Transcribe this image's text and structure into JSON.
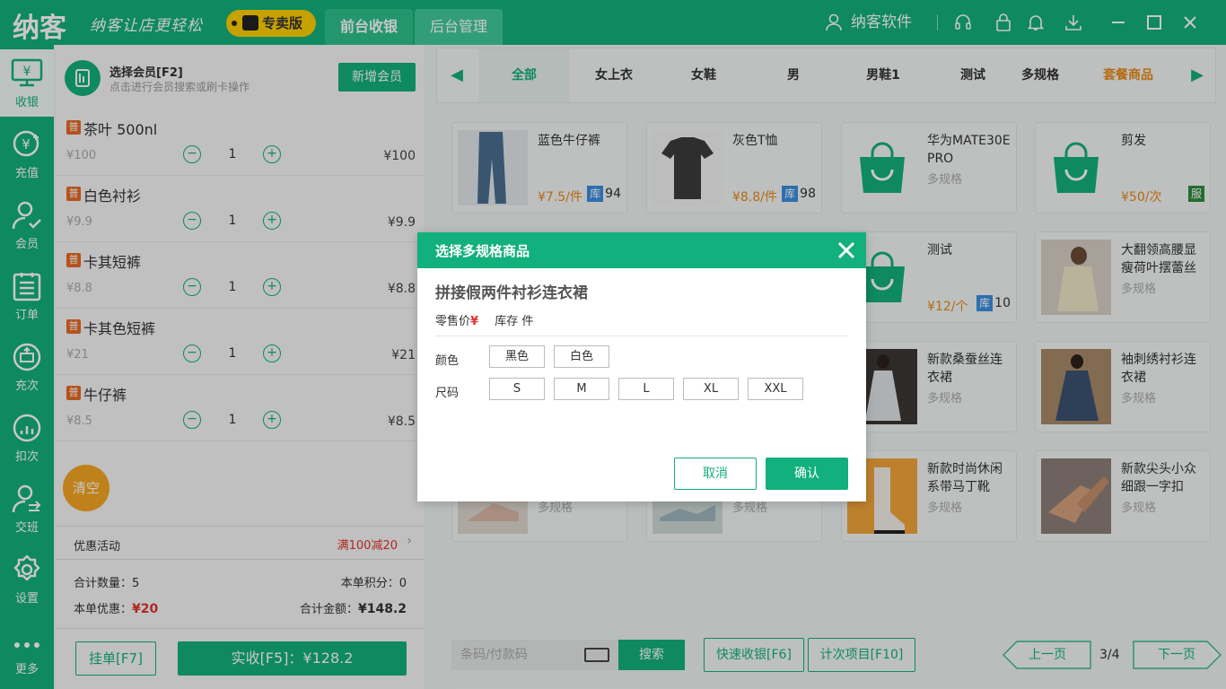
{
  "app": {
    "logo": "纳客",
    "slogan": "纳客让店更轻松",
    "edition": "专卖版",
    "tabs": [
      "前台收银",
      "后台管理"
    ],
    "user": "纳客软件"
  },
  "sidebar": [
    {
      "label": "收银",
      "icon": "cashier-icon"
    },
    {
      "label": "充值",
      "icon": "recharge-icon"
    },
    {
      "label": "会员",
      "icon": "member-icon"
    },
    {
      "label": "订单",
      "icon": "order-icon"
    },
    {
      "label": "充次",
      "icon": "recharge-times-icon"
    },
    {
      "label": "扣次",
      "icon": "deduct-times-icon"
    },
    {
      "label": "交班",
      "icon": "handover-icon"
    },
    {
      "label": "设置",
      "icon": "settings-icon"
    },
    {
      "label": "更多",
      "icon": "more-icon"
    }
  ],
  "member": {
    "title": "选择会员[F2]",
    "subtitle": "点击进行会员搜索或刷卡操作",
    "add_button": "新增会员"
  },
  "cart": [
    {
      "badge": "普",
      "name": "茶叶 500nl",
      "price": "¥100",
      "qty": "1",
      "total": "¥100"
    },
    {
      "badge": "普",
      "name": "白色衬衫",
      "price": "¥9.9",
      "qty": "1",
      "total": "¥9.9"
    },
    {
      "badge": "普",
      "name": "卡其短裤",
      "price": "¥8.8",
      "qty": "1",
      "total": "¥8.8"
    },
    {
      "badge": "普",
      "name": "卡其色短裤",
      "price": "¥21",
      "qty": "1",
      "total": "¥21"
    },
    {
      "badge": "普",
      "name": "牛仔裤",
      "price": "¥8.5",
      "qty": "1",
      "total": "¥8.5"
    }
  ],
  "clear_label": "清空",
  "promo": {
    "label": "优惠活动",
    "value": "满100减20"
  },
  "summary": {
    "qty_label": "合计数量：",
    "qty": "5",
    "points_label": "本单积分：",
    "points": "0",
    "discount_label": "本单优惠：",
    "discount": "¥20",
    "amount_label": "合计金额：",
    "amount": "¥148.2"
  },
  "actions": {
    "hold": "挂单[F7]",
    "pay": "实收[F5]：¥128.2"
  },
  "categories": [
    "全部",
    "女上衣",
    "女鞋",
    "男",
    "男鞋1",
    "测试",
    "多规格",
    "套餐商品"
  ],
  "products": [
    {
      "name": "蓝色牛仔裤",
      "price": "¥7.5/件",
      "stock_badge": "库",
      "stock": "94"
    },
    {
      "name": "灰色T恤",
      "price": "¥8.8/件",
      "stock_badge": "库",
      "stock": "98"
    },
    {
      "name": "华为MATE30E PRO",
      "spec": "多规格"
    },
    {
      "name": "剪发",
      "price": "¥50/次",
      "badge": "服"
    },
    {
      "name": "测试",
      "price": "¥12/个",
      "stock_badge": "库",
      "stock": "10"
    },
    {
      "name": "大翻领高腰显瘦荷叶摆蕾丝",
      "spec": "多规格"
    },
    {
      "name": "新款桑蚕丝连衣裙",
      "spec": "多规格"
    },
    {
      "name": "袖刺绣衬衫连衣裙",
      "spec": "多规格"
    },
    {
      "name": "",
      "spec": "多规格"
    },
    {
      "name": "",
      "spec": "多规格"
    },
    {
      "name": "新款时尚休闲系带马丁靴",
      "spec": "多规格"
    },
    {
      "name": "新款尖头小众细跟一字扣",
      "spec": "多规格"
    }
  ],
  "search": {
    "placeholder": "条码/付款码",
    "button": "搜索"
  },
  "quick": {
    "fast_checkout": "快速收银[F6]",
    "count_item": "计次项目[F10]"
  },
  "pager": {
    "prev": "上一页",
    "page": "3/4",
    "next": "下一页"
  },
  "dialog": {
    "title": "选择多规格商品",
    "product": "拼接假两件衬衫连衣裙",
    "price_label": "零售价",
    "yen": "¥",
    "stock_label": "库存 件",
    "color_label": "颜色",
    "colors": [
      "黑色",
      "白色"
    ],
    "size_label": "尺码",
    "sizes": [
      "S",
      "M",
      "L",
      "XL",
      "XXL"
    ],
    "cancel": "取消",
    "ok": "确认"
  },
  "colors": {
    "primary": "#12b07c",
    "accent_orange": "#e88a1a",
    "red": "#e0322c",
    "yellow": "#fdd000"
  }
}
